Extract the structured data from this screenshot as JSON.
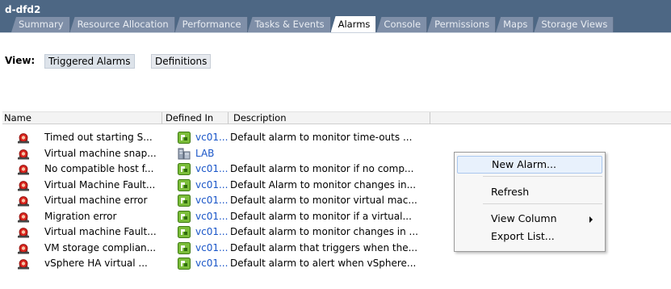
{
  "window": {
    "title": "d-dfd2"
  },
  "tabs": [
    {
      "label": "Summary"
    },
    {
      "label": "Resource Allocation"
    },
    {
      "label": "Performance"
    },
    {
      "label": "Tasks & Events"
    },
    {
      "label": "Alarms"
    },
    {
      "label": "Console"
    },
    {
      "label": "Permissions"
    },
    {
      "label": "Maps"
    },
    {
      "label": "Storage Views"
    }
  ],
  "active_tab": "Alarms",
  "view": {
    "label": "View:",
    "triggered_label": "Triggered Alarms",
    "definitions_label": "Definitions"
  },
  "table": {
    "columns": [
      "Name",
      "Defined In",
      "Description"
    ],
    "rows": [
      {
        "name": "Timed out starting S...",
        "defined_in": "vc01...",
        "defined_icon": "cluster-icon",
        "description": "Default alarm to monitor time-outs ..."
      },
      {
        "name": "Virtual machine snap...",
        "defined_in": "LAB",
        "defined_icon": "datacenter-icon",
        "description": ""
      },
      {
        "name": "No compatible host f...",
        "defined_in": "vc01...",
        "defined_icon": "cluster-icon",
        "description": "Default alarm to monitor if no comp..."
      },
      {
        "name": "Virtual Machine Fault...",
        "defined_in": "vc01...",
        "defined_icon": "cluster-icon",
        "description": "Default Alarm to monitor changes in..."
      },
      {
        "name": "Virtual machine error",
        "defined_in": "vc01...",
        "defined_icon": "cluster-icon",
        "description": "Default alarm to monitor virtual mac..."
      },
      {
        "name": "Migration error",
        "defined_in": "vc01...",
        "defined_icon": "cluster-icon",
        "description": "Default alarm to monitor if a virtual..."
      },
      {
        "name": "Virtual machine Fault...",
        "defined_in": "vc01...",
        "defined_icon": "cluster-icon",
        "description": "Default alarm to monitor changes in ..."
      },
      {
        "name": "VM storage complian...",
        "defined_in": "vc01...",
        "defined_icon": "cluster-icon",
        "description": "Default alarm that triggers when the..."
      },
      {
        "name": "vSphere HA virtual ...",
        "defined_in": "vc01...",
        "defined_icon": "cluster-icon",
        "description": "Default alarm to alert when vSphere..."
      }
    ]
  },
  "context_menu": {
    "items": [
      {
        "label": "New Alarm...",
        "highlighted": true
      },
      {
        "label": "Refresh"
      },
      {
        "label": "View Column",
        "submenu": true
      },
      {
        "label": "Export List..."
      }
    ]
  },
  "colors": {
    "titlebar": "#4d6784",
    "tab_inactive": "#7f8fa8",
    "link": "#1a56c8",
    "menu_highlight": "#e8f1fc"
  }
}
